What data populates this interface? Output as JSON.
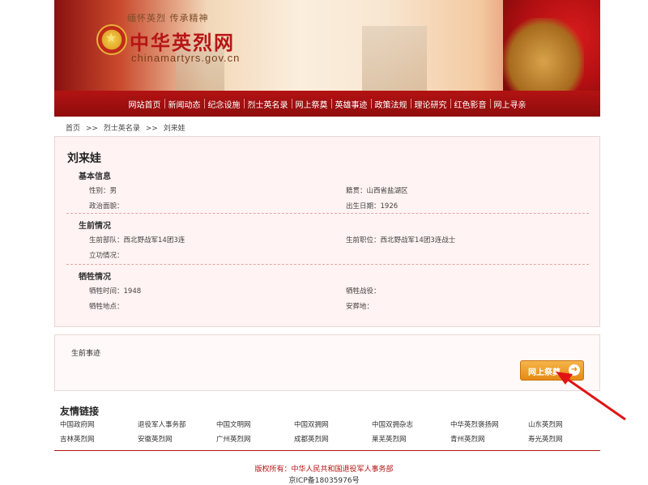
{
  "header": {
    "slogan": "缅怀英烈 传承精神",
    "site_name": "中华英烈网",
    "domain": "chinamartyrs.gov.cn"
  },
  "nav": [
    "网站首页",
    "新闻动态",
    "纪念设施",
    "烈士英名录",
    "网上祭奠",
    "英雄事迹",
    "政策法规",
    "理论研究",
    "红色影音",
    "网上寻亲"
  ],
  "breadcrumb": [
    "首页",
    ">>",
    "烈士英名录",
    ">>",
    "刘来娃"
  ],
  "person": {
    "name": "刘来娃",
    "basic": {
      "title": "基本信息",
      "gender": "性别：男",
      "origin": "籍贯：山西省盐湖区",
      "political": "政治面貌：",
      "birth": "出生日期：1926"
    },
    "life": {
      "title": "生前情况",
      "unit": "生前部队：西北野战军14团3连",
      "position": "生前职位：西北野战军14团3连战士",
      "merit": "立功情况："
    },
    "sacrifice": {
      "title": "牺牲情况",
      "time": "牺牲时间：1948",
      "battle": "牺牲战役：",
      "place": "牺牲地点：",
      "burial": "安葬地："
    }
  },
  "deeds": {
    "title": "生前事迹",
    "tribute_button": "网上祭奠"
  },
  "links": {
    "title": "友情链接",
    "row1": [
      "中国政府网",
      "退役军人事务部",
      "中国文明网",
      "中国双拥网",
      "中国双拥杂志",
      "中华英烈褒扬网",
      "山东英烈网"
    ],
    "row2": [
      "吉林英烈网",
      "安徽英烈网",
      "广州英烈网",
      "成都英烈网",
      "莱芜英烈网",
      "青州英烈网",
      "寿光英烈网"
    ]
  },
  "footer": {
    "copyright": "版权所有：中华人民共和国退役军人事务部",
    "icp": "京ICP备18035976号"
  },
  "colors": {
    "brand_red": "#b31313",
    "button_orange": "#e58a14"
  }
}
